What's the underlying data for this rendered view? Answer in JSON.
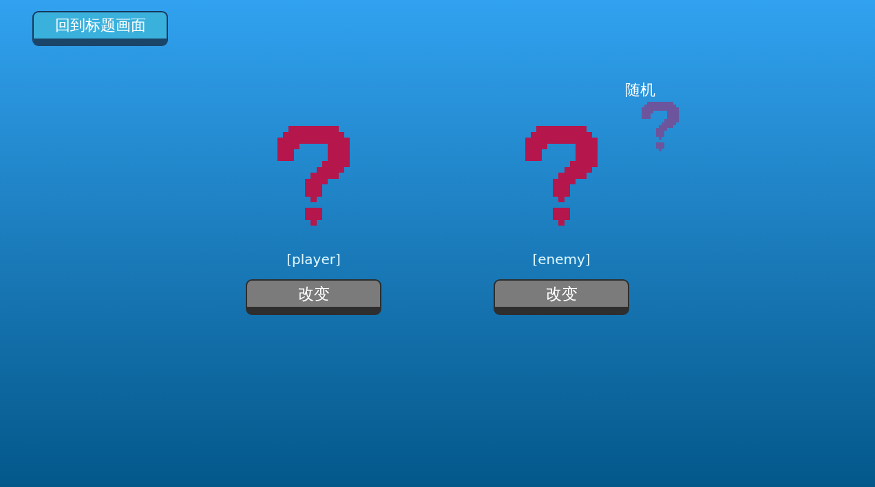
{
  "title_button": {
    "label": "回到标题画面"
  },
  "slots": [
    {
      "name": "[player]",
      "button": "改变"
    },
    {
      "name": "[enemy]",
      "button": "改变"
    }
  ],
  "random": {
    "label": "随机"
  }
}
